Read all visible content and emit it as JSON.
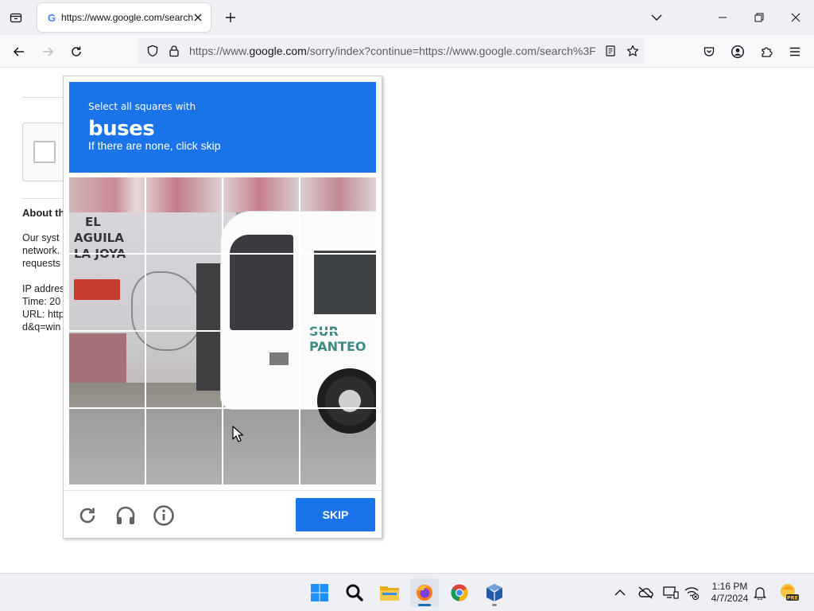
{
  "browser": {
    "tab": {
      "title": "https://www.google.com/search",
      "favicon": "google-g-icon"
    },
    "url": {
      "prefix": "https://www.",
      "domain": "google.com",
      "rest": "/sorry/index?continue=https://www.google.com/search%3F"
    },
    "icons": {
      "tab_list": "tab-list-icon",
      "new_tab": "plus-icon",
      "tab_overflow": "chevron-down-icon",
      "minimize": "minimize-icon",
      "maximize": "restore-icon",
      "close": "close-icon",
      "back": "back-arrow-icon",
      "forward": "forward-arrow-icon",
      "reload": "reload-icon",
      "tracking": "shield-icon",
      "lock": "lock-icon",
      "reader": "reader-view-icon",
      "bookmark": "star-icon",
      "pocket": "pocket-icon",
      "account": "account-icon",
      "extensions": "puzzle-icon",
      "menu": "hamburger-menu-icon"
    }
  },
  "page": {
    "about_heading": "About th",
    "lines": [
      "Our syst",
      "network.",
      "requests",
      "",
      "IP addres",
      "Time: 20",
      "URL: http",
      "d&q=win"
    ]
  },
  "captcha": {
    "prompt": "Select all squares with",
    "target": "buses",
    "hint": "If there are none, click skip",
    "grid": {
      "rows": 4,
      "cols": 4
    },
    "scene_text": {
      "wall": [
        "EL",
        "AGUILA",
        "LA JOYA"
      ],
      "bus_side": "SUR PANTEO"
    },
    "skip_label": "SKIP",
    "controls": [
      "reload-icon",
      "headphones-icon",
      "info-icon"
    ],
    "colors": {
      "accent": "#1a73e8"
    }
  },
  "taskbar": {
    "apps": [
      "windows-start-icon",
      "search-icon",
      "file-explorer-icon",
      "firefox-icon",
      "chrome-icon",
      "virtualbox-icon"
    ],
    "active_app": "firefox-icon",
    "tray": [
      "chevron-up-icon",
      "onedrive-offline-icon",
      "display-icon",
      "network-offline-icon"
    ],
    "time": "1:16 PM",
    "date": "4/7/2024",
    "notification": "bell-icon",
    "badge_text": "PRE"
  }
}
